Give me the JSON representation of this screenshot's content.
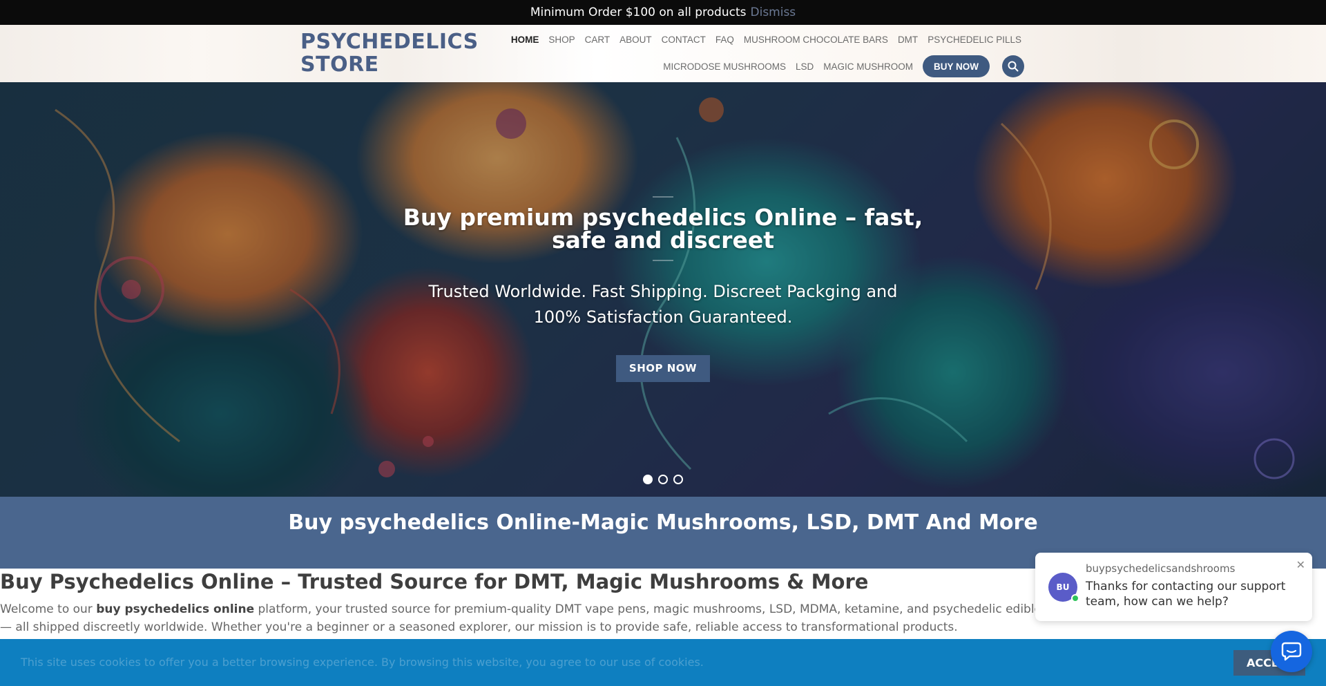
{
  "notice": {
    "text": "Minimum Order $100 on all products",
    "dismiss": "Dismiss"
  },
  "header": {
    "logo_line1": "PSYCHEDELICS",
    "logo_line2": "STORE",
    "nav_row1": [
      "HOME",
      "SHOP",
      "CART",
      "ABOUT",
      "CONTACT",
      "FAQ",
      "MUSHROOM CHOCOLATE BARS",
      "DMT",
      "PSYCHEDELIC PILLS"
    ],
    "nav_row2": [
      "MICRODOSE MUSHROOMS",
      "LSD",
      "MAGIC MUSHROOM"
    ],
    "buy_now": "BUY NOW",
    "active_item": "HOME"
  },
  "hero": {
    "title": "Buy  premium psychedelics Online – fast, safe and discreet",
    "subtitle": "Trusted Worldwide. Fast Shipping. Discreet Packging and 100% Satisfaction Guaranteed.",
    "cta": "SHOP NOW",
    "slides": 3,
    "active_slide": 1
  },
  "banner": {
    "title": "Buy psychedelics Online-Magic Mushrooms, LSD, DMT And More"
  },
  "content": {
    "heading": "Buy Psychedelics Online – Trusted Source for DMT, Magic Mushrooms & More",
    "para_pre": "Welcome to our ",
    "para_bold": "buy psychedelics online",
    "para_post": " platform, your trusted source for premium-quality DMT vape pens, magic mushrooms, LSD, MDMA, ketamine, and psychedelic edibles — all shipped discreetly worldwide. Whether you're a beginner or a seasoned explorer, our mission is to provide safe, reliable access to transformational products."
  },
  "chat": {
    "avatar_initials": "BU",
    "name": "buypsychedelicsandshrooms",
    "message": "Thanks for contacting our support team, how can we help?"
  },
  "cookie": {
    "text": "This site uses cookies to offer you a better browsing experience. By browsing this website, you agree to our use of cookies.",
    "accept": "ACCEPT"
  },
  "colors": {
    "brand": "#4a668e",
    "button": "#3f5a80",
    "cookie_bg": "#0e7fc0",
    "launcher": "#1566e0"
  }
}
